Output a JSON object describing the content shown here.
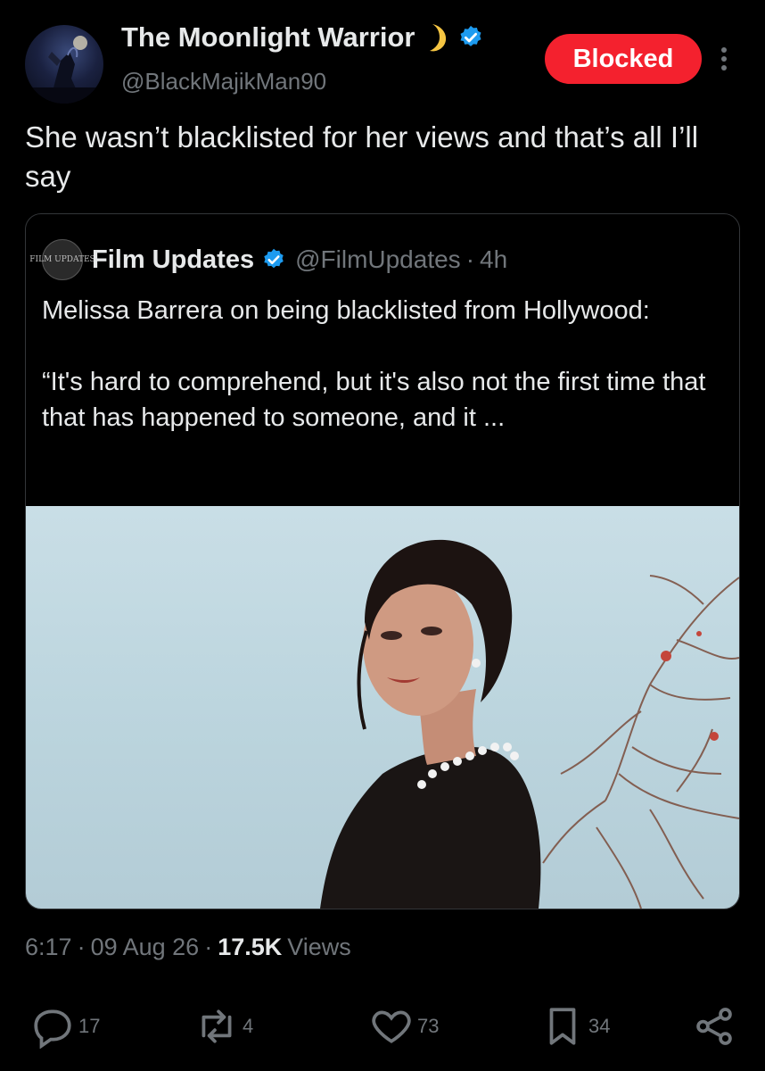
{
  "author": {
    "display_name": "The Moonlight Warrior",
    "handle": "@BlackMajikMan90",
    "avatar_icon": "avatar-moonlight-warrior",
    "verified": true
  },
  "badge": {
    "label": "Blocked",
    "color": "#f4212e"
  },
  "tweet": {
    "text": "She wasn’t blacklisted for her views and that’s all I’ll say"
  },
  "quote": {
    "avatar_text": "FILM UPDATES",
    "name": "Film Updates",
    "handle": "@FilmUpdates",
    "separator": "·",
    "time": "4h",
    "text_line1": "Melissa Barrera on being blacklisted from Hollywood:",
    "text_line2": "“It's hard to comprehend, but it's also not the first time that that has happened to someone, and it ..."
  },
  "meta": {
    "time": "6:17",
    "sep1": "·",
    "date": "09 Aug 26",
    "sep2": "·",
    "views_count": "17.5K",
    "views_label": "Views"
  },
  "actions": {
    "replies": "17",
    "reposts": "4",
    "likes": "73",
    "bookmarks": "34"
  },
  "colors": {
    "background": "#000000",
    "text_primary": "#e7e9ea",
    "text_secondary": "#71767b",
    "verified": "#1d9bf0",
    "border": "#333639"
  }
}
